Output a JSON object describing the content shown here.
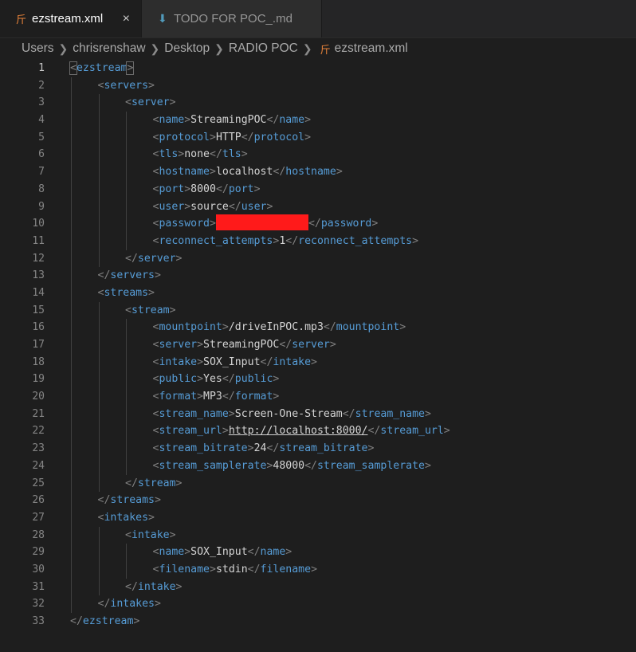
{
  "tabs": [
    {
      "label": "ezstream.xml",
      "icon": "rss-icon",
      "active": true,
      "close": "×"
    },
    {
      "label": "TODO FOR POC_.md",
      "icon": "markdown-icon",
      "active": false
    }
  ],
  "breadcrumb": [
    "Users",
    "chrisrenshaw",
    "Desktop",
    "RADIO POC",
    "ezstream.xml"
  ],
  "editor": {
    "current_line": 1,
    "lines": [
      {
        "n": "1",
        "depth": 0,
        "tag": "ezstream",
        "kind": "open"
      },
      {
        "n": "2",
        "depth": 1,
        "tag": "servers",
        "kind": "open"
      },
      {
        "n": "3",
        "depth": 2,
        "tag": "server",
        "kind": "open"
      },
      {
        "n": "4",
        "depth": 3,
        "tag": "name",
        "kind": "leaf",
        "text": "StreamingPOC"
      },
      {
        "n": "5",
        "depth": 3,
        "tag": "protocol",
        "kind": "leaf",
        "text": "HTTP"
      },
      {
        "n": "6",
        "depth": 3,
        "tag": "tls",
        "kind": "leaf",
        "text": "none"
      },
      {
        "n": "7",
        "depth": 3,
        "tag": "hostname",
        "kind": "leaf",
        "text": "localhost"
      },
      {
        "n": "8",
        "depth": 3,
        "tag": "port",
        "kind": "leaf",
        "text": "8000"
      },
      {
        "n": "9",
        "depth": 3,
        "tag": "user",
        "kind": "leaf",
        "text": "source"
      },
      {
        "n": "10",
        "depth": 3,
        "tag": "password",
        "kind": "redacted"
      },
      {
        "n": "11",
        "depth": 3,
        "tag": "reconnect_attempts",
        "kind": "leaf",
        "text": "1"
      },
      {
        "n": "12",
        "depth": 2,
        "tag": "server",
        "kind": "close"
      },
      {
        "n": "13",
        "depth": 1,
        "tag": "servers",
        "kind": "close"
      },
      {
        "n": "14",
        "depth": 1,
        "tag": "streams",
        "kind": "open"
      },
      {
        "n": "15",
        "depth": 2,
        "tag": "stream",
        "kind": "open"
      },
      {
        "n": "16",
        "depth": 3,
        "tag": "mountpoint",
        "kind": "leaf",
        "text": "/driveInPOC.mp3"
      },
      {
        "n": "17",
        "depth": 3,
        "tag": "server",
        "kind": "leaf",
        "text": "StreamingPOC"
      },
      {
        "n": "18",
        "depth": 3,
        "tag": "intake",
        "kind": "leaf",
        "text": "SOX_Input"
      },
      {
        "n": "19",
        "depth": 3,
        "tag": "public",
        "kind": "leaf",
        "text": "Yes"
      },
      {
        "n": "20",
        "depth": 3,
        "tag": "format",
        "kind": "leaf",
        "text": "MP3"
      },
      {
        "n": "21",
        "depth": 3,
        "tag": "stream_name",
        "kind": "leaf",
        "text": "Screen-One-Stream"
      },
      {
        "n": "22",
        "depth": 3,
        "tag": "stream_url",
        "kind": "leaf",
        "text": "http://localhost:8000/",
        "link": true
      },
      {
        "n": "23",
        "depth": 3,
        "tag": "stream_bitrate",
        "kind": "leaf",
        "text": "24"
      },
      {
        "n": "24",
        "depth": 3,
        "tag": "stream_samplerate",
        "kind": "leaf",
        "text": "48000"
      },
      {
        "n": "25",
        "depth": 2,
        "tag": "stream",
        "kind": "close"
      },
      {
        "n": "26",
        "depth": 1,
        "tag": "streams",
        "kind": "close"
      },
      {
        "n": "27",
        "depth": 1,
        "tag": "intakes",
        "kind": "open"
      },
      {
        "n": "28",
        "depth": 2,
        "tag": "intake",
        "kind": "open"
      },
      {
        "n": "29",
        "depth": 3,
        "tag": "name",
        "kind": "leaf",
        "text": "SOX_Input"
      },
      {
        "n": "30",
        "depth": 3,
        "tag": "filename",
        "kind": "leaf",
        "text": "stdin"
      },
      {
        "n": "31",
        "depth": 2,
        "tag": "intake",
        "kind": "close"
      },
      {
        "n": "32",
        "depth": 1,
        "tag": "intakes",
        "kind": "close"
      },
      {
        "n": "33",
        "depth": 0,
        "tag": "ezstream",
        "kind": "close"
      }
    ]
  },
  "colors": {
    "background": "#1e1e1e",
    "tag_name": "#569cd6",
    "bracket": "#808080",
    "text": "#d4d4d4",
    "redaction": "#ff1a1a",
    "rss_icon": "#e8833a",
    "markdown_icon": "#519aba"
  }
}
